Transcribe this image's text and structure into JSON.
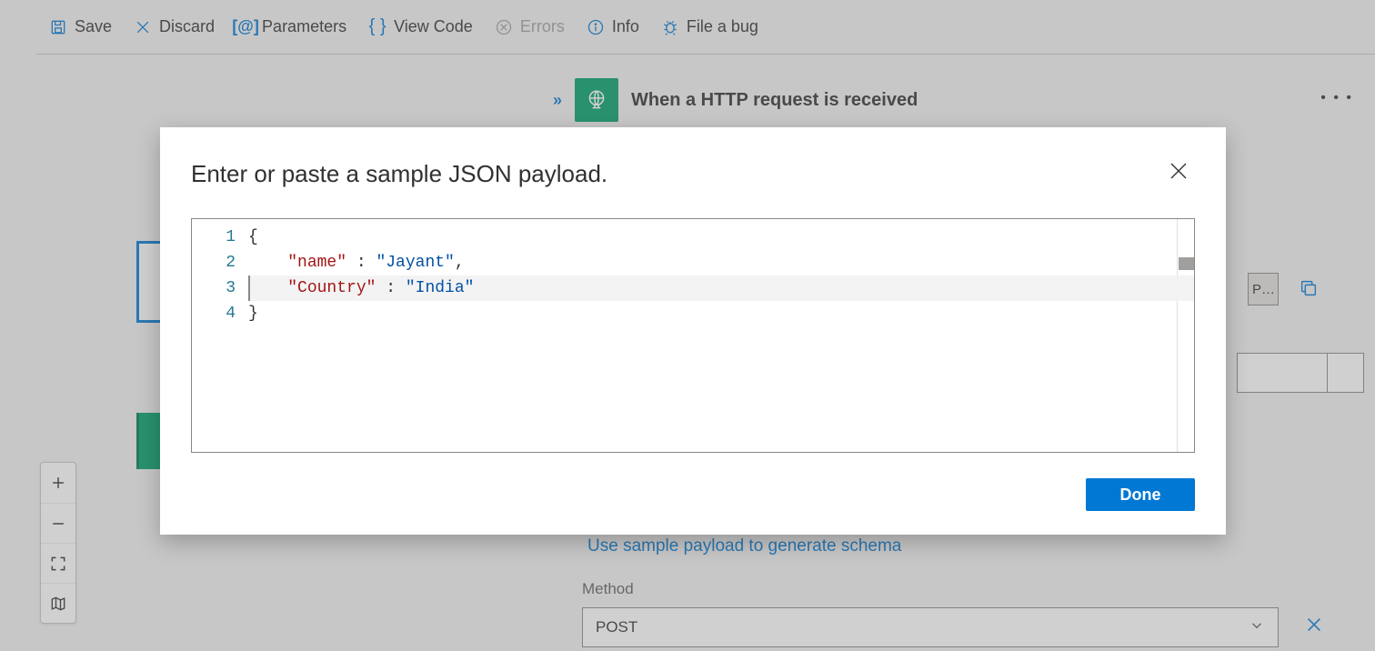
{
  "toolbar": {
    "save": "Save",
    "discard": "Discard",
    "parameters": "Parameters",
    "view_code": "View Code",
    "errors": "Errors",
    "info": "Info",
    "file_bug": "File a bug"
  },
  "trigger": {
    "collapse_glyph": "»",
    "title": "When a HTTP request is received",
    "more_glyph": "• • •",
    "peek_label": "P…"
  },
  "sample_link": "Use sample payload to generate schema",
  "method": {
    "label": "Method",
    "value": "POST"
  },
  "modal": {
    "title": "Enter or paste a sample JSON payload.",
    "done": "Done",
    "code": {
      "lines": [
        "1",
        "2",
        "3",
        "4"
      ],
      "l1_brace": "{",
      "l2_indent": "    ",
      "l2_key": "\"name\"",
      "l2_sep": " : ",
      "l2_val": "\"Jayant\"",
      "l2_comma": ",",
      "l3_indent": "    ",
      "l3_key": "\"Country\"",
      "l3_sep": " : ",
      "l3_val": "\"India\"",
      "l4_brace": "}"
    }
  }
}
